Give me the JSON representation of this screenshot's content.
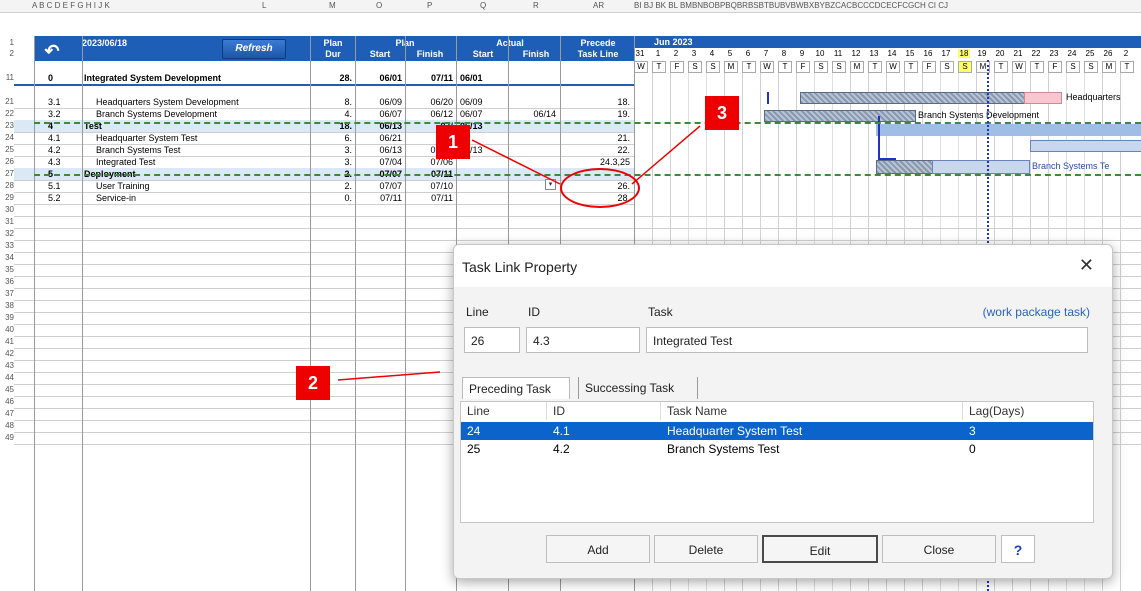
{
  "sheet": {
    "column_letters": "A  B  C D E F G H I  J  K",
    "col_L": "L",
    "col_M": "M",
    "col_O": "O",
    "col_P": "P",
    "col_Q": "Q",
    "col_R": "R",
    "col_AR": "AR",
    "gantt_cols": "BI BJ BK BL BMBNBOBPBQBRBSBTBUBVBWBXBYBZCACBCCCDCECFCGCH CI CJ",
    "date": "2023/06/18",
    "refresh_label": "Refresh",
    "undo_icon": "↶",
    "headers": {
      "plan_dur": "Plan Dur",
      "plan_dur_1": "Plan",
      "plan_dur_2": "Dur",
      "plan": "Plan",
      "plan_start": "Start",
      "plan_finish": "Finish",
      "actual": "Actual",
      "actual_start": "Start",
      "actual_finish": "Finish",
      "precede_1": "Precede",
      "precede_2": "Task Line"
    },
    "gantt_month": "Jun 2023",
    "gantt_days": [
      "31",
      "1",
      "2",
      "3",
      "4",
      "5",
      "6",
      "7",
      "8",
      "9",
      "10",
      "11",
      "12",
      "13",
      "14",
      "15",
      "16",
      "17",
      "18",
      "19",
      "20",
      "21",
      "22",
      "23",
      "24",
      "25",
      "26",
      "2"
    ],
    "gantt_weekdays": [
      "W",
      "T",
      "F",
      "S",
      "S",
      "M",
      "T",
      "W",
      "T",
      "F",
      "S",
      "S",
      "M",
      "T",
      "W",
      "T",
      "F",
      "S",
      "S",
      "M",
      "T",
      "W",
      "T",
      "F",
      "S",
      "S",
      "M",
      "T"
    ],
    "rows": [
      {
        "num": "11",
        "wbs": "0",
        "name": "Integrated System Development",
        "dur": "28.",
        "ps": "06/01",
        "pf": "07/11",
        "as": "06/01",
        "af": "",
        "pred": "",
        "bold": true,
        "section": false
      },
      {
        "num": "21",
        "wbs": "3.1",
        "name": "Headquarters System Development",
        "dur": "8.",
        "ps": "06/09",
        "pf": "06/20",
        "as": "06/09",
        "af": "",
        "pred": "18.",
        "bold": false,
        "section": false
      },
      {
        "num": "22",
        "wbs": "3.2",
        "name": "Branch Systems Development",
        "dur": "4.",
        "ps": "06/07",
        "pf": "06/12",
        "as": "06/07",
        "af": "06/14",
        "pred": "19.",
        "bold": false,
        "section": false
      },
      {
        "num": "23",
        "wbs": "4",
        "name": "Test",
        "dur": "18.",
        "ps": "06/13",
        "pf": "07/",
        "as": "06/13",
        "af": "",
        "pred": "",
        "bold": true,
        "section": true
      },
      {
        "num": "24",
        "wbs": "4.1",
        "name": "Headquarter System Test",
        "dur": "6.",
        "ps": "06/21",
        "pf": "",
        "as": "",
        "af": "",
        "pred": "21.",
        "bold": false,
        "section": false
      },
      {
        "num": "25",
        "wbs": "4.2",
        "name": "Branch Systems Test",
        "dur": "3.",
        "ps": "06/13",
        "pf": "06/15",
        "as": "06/13",
        "af": "",
        "pred": "22.",
        "bold": false,
        "section": false
      },
      {
        "num": "26",
        "wbs": "4.3",
        "name": "Integrated Test",
        "dur": "3.",
        "ps": "07/04",
        "pf": "07/06",
        "as": "",
        "af": "",
        "pred": "24.3,25",
        "bold": false,
        "section": false
      },
      {
        "num": "27",
        "wbs": "5",
        "name": "Deployment",
        "dur": "2.",
        "ps": "07/07",
        "pf": "07/11",
        "as": "",
        "af": "",
        "pred": "",
        "bold": true,
        "section": true
      },
      {
        "num": "28",
        "wbs": "5.1",
        "name": "User Training",
        "dur": "2.",
        "ps": "07/07",
        "pf": "07/10",
        "as": "",
        "af": "",
        "pred": "26.",
        "bold": false,
        "section": false
      },
      {
        "num": "29",
        "wbs": "5.2",
        "name": "Service-in",
        "dur": "0.",
        "ps": "07/11",
        "pf": "07/11",
        "as": "",
        "af": "",
        "pred": "28.",
        "bold": false,
        "section": false
      }
    ],
    "empty_rows": [
      "30",
      "31",
      "32",
      "33",
      "34",
      "35",
      "36",
      "37",
      "38",
      "39",
      "40",
      "41",
      "42",
      "43",
      "44",
      "45",
      "46",
      "47",
      "48",
      "49"
    ],
    "row_header_1": "1",
    "row_header_2": "2",
    "gantt_labels": {
      "hq_dev": "Headquarters",
      "branch_dev": "Branch Systems Development",
      "branch_test": "Branch Systems Te"
    }
  },
  "callouts": [
    "1",
    "2",
    "3"
  ],
  "dialog": {
    "title": "Task Link Property",
    "close_icon": "✕",
    "line_label": "Line",
    "id_label": "ID",
    "task_label": "Task",
    "wp_link": "(work package task)",
    "line_value": "26",
    "id_value": "4.3",
    "task_value": "Integrated Test",
    "tabs": [
      "Preceding Task",
      "Successing Task"
    ],
    "list_headers": [
      "Line",
      "ID",
      "Task Name",
      "Lag(Days)"
    ],
    "list_rows": [
      {
        "line": "24",
        "id": "4.1",
        "name": "Headquarter System Test",
        "lag": "3"
      },
      {
        "line": "25",
        "id": "4.2",
        "name": "Branch Systems Test",
        "lag": "0"
      }
    ],
    "buttons": {
      "add": "Add",
      "delete": "Delete",
      "edit": "Edit",
      "close": "Close",
      "help": "?"
    }
  },
  "colors": {
    "header_blue": "#1f5eb6",
    "section_fill": "#dbe9f6",
    "selection": "#0b64cc",
    "callout_red": "#e00000",
    "today": "#ffff66"
  }
}
